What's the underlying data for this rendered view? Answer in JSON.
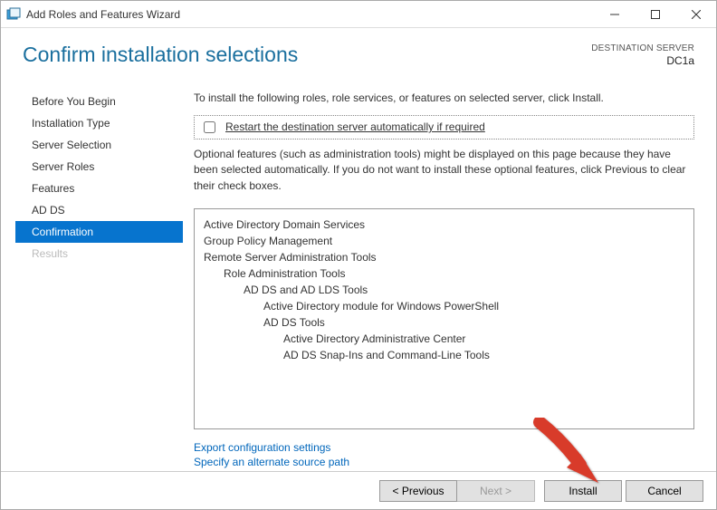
{
  "window": {
    "title": "Add Roles and Features Wizard"
  },
  "header": {
    "title": "Confirm installation selections",
    "dest_label": "DESTINATION SERVER",
    "dest_value": "DC1a"
  },
  "steps": [
    {
      "label": "Before You Begin",
      "state": "done"
    },
    {
      "label": "Installation Type",
      "state": "done"
    },
    {
      "label": "Server Selection",
      "state": "done"
    },
    {
      "label": "Server Roles",
      "state": "done"
    },
    {
      "label": "Features",
      "state": "done"
    },
    {
      "label": "AD DS",
      "state": "done"
    },
    {
      "label": "Confirmation",
      "state": "sel"
    },
    {
      "label": "Results",
      "state": "dis"
    }
  ],
  "pane": {
    "intro": "To install the following roles, role services, or features on selected server, click Install.",
    "restart_label": "Restart the destination server automatically if required",
    "restart_checked": false,
    "optional_note": "Optional features (such as administration tools) might be displayed on this page because they have been selected automatically. If you do not want to install these optional features, click Previous to clear their check boxes.",
    "tree": [
      {
        "lvl": 0,
        "text": "Active Directory Domain Services"
      },
      {
        "lvl": 0,
        "text": "Group Policy Management"
      },
      {
        "lvl": 0,
        "text": "Remote Server Administration Tools"
      },
      {
        "lvl": 1,
        "text": "Role Administration Tools"
      },
      {
        "lvl": 2,
        "text": "AD DS and AD LDS Tools"
      },
      {
        "lvl": 3,
        "text": "Active Directory module for Windows PowerShell"
      },
      {
        "lvl": 3,
        "text": "AD DS Tools"
      },
      {
        "lvl": 4,
        "text": "Active Directory Administrative Center"
      },
      {
        "lvl": 4,
        "text": "AD DS Snap-Ins and Command-Line Tools"
      }
    ],
    "links": {
      "export": "Export configuration settings",
      "alt_source": "Specify an alternate source path"
    }
  },
  "footer": {
    "prev": "< Previous",
    "next": "Next >",
    "install": "Install",
    "cancel": "Cancel",
    "next_enabled": false
  }
}
